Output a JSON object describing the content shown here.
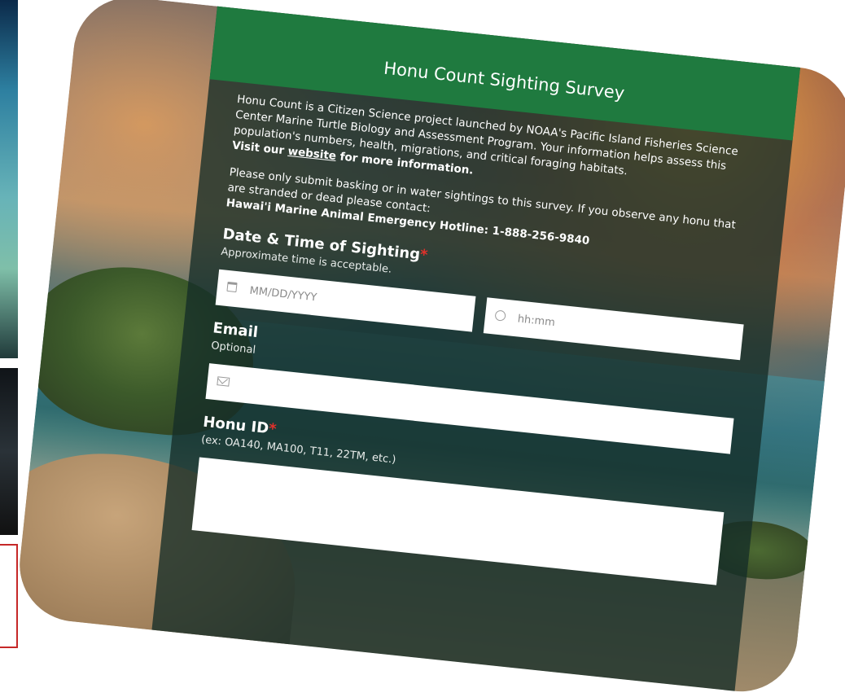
{
  "survey": {
    "title": "Honu Count Sighting Survey",
    "intro_1": "Honu Count is a Citizen Science project launched by NOAA's Pacific Island Fisheries Science Center Marine Turtle Biology and Assessment Program. Your information helps assess this population's numbers, health, migrations, and critical foraging habitats.",
    "visit_prefix": "Visit our",
    "visit_link": "website",
    "visit_suffix": "for more information.",
    "intro_2": "Please only submit basking or in water sightings to this survey. If you observe any honu that are stranded or dead please contact:",
    "hotline": "Hawai'i Marine Animal Emergency Hotline: 1-888-256-9840"
  },
  "fields": {
    "datetime": {
      "label": "Date & Time of Sighting",
      "required_mark": "*",
      "hint": "Approximate time is acceptable.",
      "date_placeholder": "MM/DD/YYYY",
      "time_placeholder": "hh:mm"
    },
    "email": {
      "label": "Email",
      "hint": "Optional"
    },
    "honu_id": {
      "label": "Honu ID",
      "required_mark": "*",
      "hint": "(ex: OA140, MA100, T11, 22TM, etc.)"
    }
  },
  "icons": {
    "date": "calendar-icon",
    "time": "clock-icon",
    "email": "envelope-icon"
  },
  "colors": {
    "header_green": "#1f7a3f",
    "required_red": "#e0312b"
  }
}
